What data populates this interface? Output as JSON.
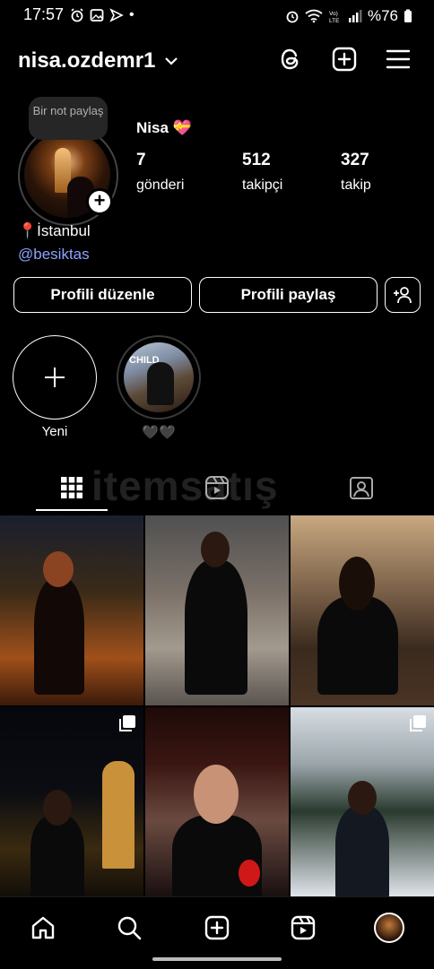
{
  "status_bar": {
    "time": "17:57",
    "battery": "%76",
    "dot": "•"
  },
  "header": {
    "username": "nisa.ozdemr1"
  },
  "profile": {
    "note_bubble": "Bir not paylaş",
    "display_name": "Nisa",
    "name_emoji": "💝",
    "stats": [
      {
        "value": "7",
        "label": "gönderi"
      },
      {
        "value": "512",
        "label": "takipçi"
      },
      {
        "value": "327",
        "label": "takip"
      }
    ],
    "bio_line1": "📍İstanbul",
    "bio_line2": "@besiktas"
  },
  "actions": {
    "edit": "Profili düzenle",
    "share": "Profili paylaş"
  },
  "highlights": {
    "new_label": "Yeni",
    "story_label": "🖤🖤",
    "story_image_text": "CHILD"
  },
  "tabs": [
    "grid-tab",
    "reels-tab",
    "tagged-tab"
  ],
  "watermark": "itemsatış",
  "grid": {
    "posts": [
      {
        "bg": "linear-gradient(180deg,#1a1f2e 0,#3a2a18 40%,#a0501a 75%,#3a1a0a 100%)",
        "multi": false
      },
      {
        "bg": "linear-gradient(180deg,#505050 0,#7a7068 40%,#a39a8e 70%,#5a5450 100%)",
        "multi": false
      },
      {
        "bg": "linear-gradient(180deg,#c7a880 0,#7a6048 40%,#3a2a1e 70%,#4a3424 100%)",
        "multi": false
      },
      {
        "bg": "linear-gradient(180deg,#05070d 0,#0b0d12 45%,#3a2a10 75%,#120e08 100%)",
        "multi": true
      },
      {
        "bg": "linear-gradient(180deg,#1e0a08 0,#3a1612 30%,#6a4a40 60%,#1a1010 100%)",
        "multi": false
      },
      {
        "bg": "linear-gradient(180deg,#d8dde4 0,#9aa5aa 30%,#2a3a2e 55%,#dfe4ea 100%)",
        "multi": true
      }
    ]
  },
  "colors": {
    "background": "#000000",
    "link": "#8da2ff",
    "note_bg": "#262626"
  }
}
